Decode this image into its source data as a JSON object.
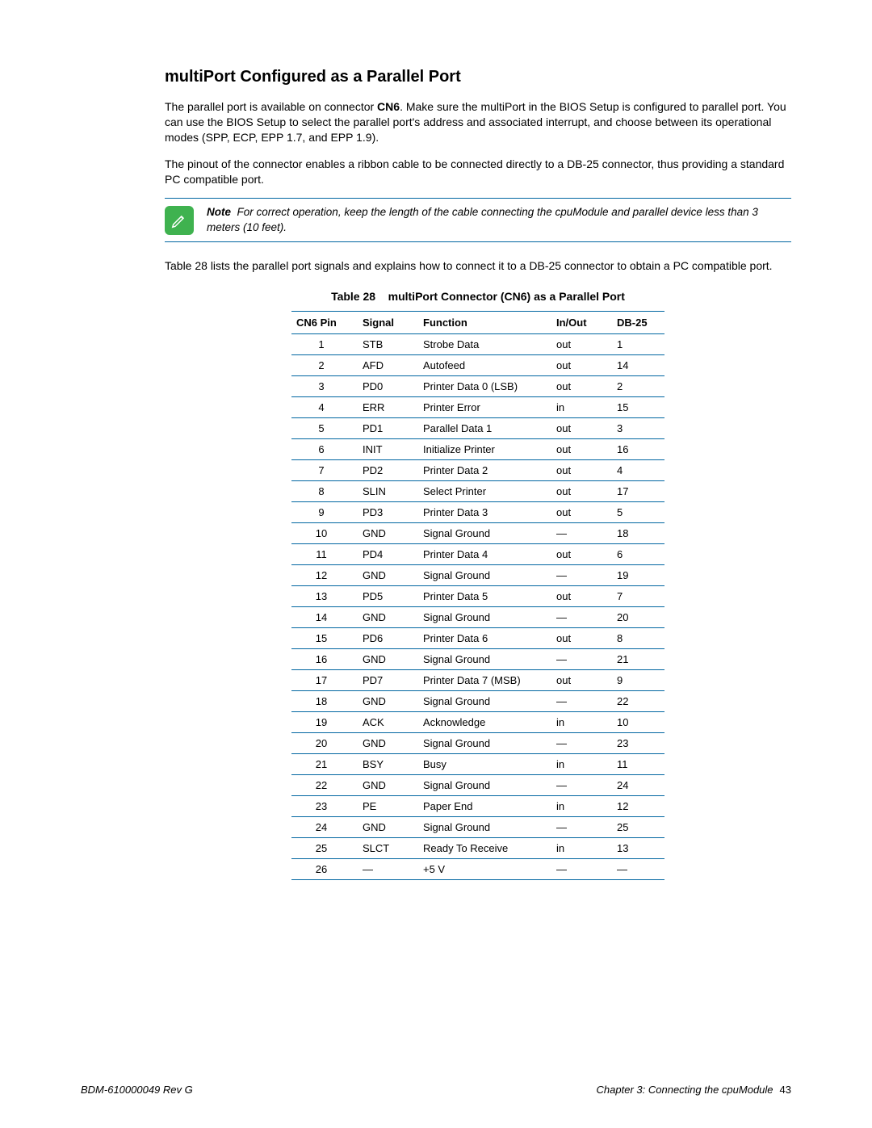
{
  "heading": "multiPort Configured as a Parallel Port",
  "para1_a": "The parallel port is available on connector ",
  "para1_bold": "CN6",
  "para1_b": ". Make sure the multiPort in the BIOS Setup is configured to parallel port. You can use the BIOS Setup to select the parallel port's address and associated interrupt, and choose between its operational modes (SPP, ECP, EPP 1.7, and EPP 1.9).",
  "para2": "The pinout of the connector enables a ribbon cable to be connected directly to a DB-25 connector, thus providing a standard PC compatible port.",
  "note_lead": "Note",
  "note_body": "For correct operation, keep the length of the cable connecting the cpuModule and parallel device less than 3 meters (10 feet).",
  "para3": "Table 28 lists the parallel port signals and explains how to connect it to a DB-25 connector to obtain a PC compatible port.",
  "table_caption_a": "Table 28",
  "table_caption_b": "multiPort Connector (CN6) as a Parallel Port",
  "headers": {
    "c0": "CN6 Pin",
    "c1": "Signal",
    "c2": "Function",
    "c3": "In/Out",
    "c4": "DB-25"
  },
  "rows": [
    {
      "pin": "1",
      "sig": "STB",
      "fn": "Strobe Data",
      "io": "out",
      "db": "1"
    },
    {
      "pin": "2",
      "sig": "AFD",
      "fn": "Autofeed",
      "io": "out",
      "db": "14"
    },
    {
      "pin": "3",
      "sig": "PD0",
      "fn": "Printer Data 0 (LSB)",
      "io": "out",
      "db": "2"
    },
    {
      "pin": "4",
      "sig": "ERR",
      "fn": "Printer Error",
      "io": "in",
      "db": "15"
    },
    {
      "pin": "5",
      "sig": "PD1",
      "fn": "Parallel Data 1",
      "io": "out",
      "db": "3"
    },
    {
      "pin": "6",
      "sig": "INIT",
      "fn": "Initialize Printer",
      "io": "out",
      "db": "16"
    },
    {
      "pin": "7",
      "sig": "PD2",
      "fn": "Printer Data 2",
      "io": "out",
      "db": "4"
    },
    {
      "pin": "8",
      "sig": "SLIN",
      "fn": "Select Printer",
      "io": "out",
      "db": "17"
    },
    {
      "pin": "9",
      "sig": "PD3",
      "fn": "Printer Data 3",
      "io": "out",
      "db": "5"
    },
    {
      "pin": "10",
      "sig": "GND",
      "fn": "Signal Ground",
      "io": "—",
      "db": "18"
    },
    {
      "pin": "11",
      "sig": "PD4",
      "fn": "Printer Data 4",
      "io": "out",
      "db": "6"
    },
    {
      "pin": "12",
      "sig": "GND",
      "fn": "Signal Ground",
      "io": "—",
      "db": "19"
    },
    {
      "pin": "13",
      "sig": "PD5",
      "fn": "Printer Data 5",
      "io": "out",
      "db": "7"
    },
    {
      "pin": "14",
      "sig": "GND",
      "fn": "Signal Ground",
      "io": "—",
      "db": "20"
    },
    {
      "pin": "15",
      "sig": "PD6",
      "fn": "Printer Data 6",
      "io": "out",
      "db": "8"
    },
    {
      "pin": "16",
      "sig": "GND",
      "fn": "Signal Ground",
      "io": "—",
      "db": "21"
    },
    {
      "pin": "17",
      "sig": "PD7",
      "fn": "Printer Data 7 (MSB)",
      "io": "out",
      "db": "9"
    },
    {
      "pin": "18",
      "sig": "GND",
      "fn": "Signal Ground",
      "io": "—",
      "db": "22"
    },
    {
      "pin": "19",
      "sig": "ACK",
      "fn": "Acknowledge",
      "io": "in",
      "db": "10"
    },
    {
      "pin": "20",
      "sig": "GND",
      "fn": "Signal Ground",
      "io": "—",
      "db": "23"
    },
    {
      "pin": "21",
      "sig": "BSY",
      "fn": "Busy",
      "io": "in",
      "db": "11"
    },
    {
      "pin": "22",
      "sig": "GND",
      "fn": "Signal Ground",
      "io": "—",
      "db": "24"
    },
    {
      "pin": "23",
      "sig": "PE",
      "fn": "Paper End",
      "io": "in",
      "db": "12"
    },
    {
      "pin": "24",
      "sig": "GND",
      "fn": "Signal Ground",
      "io": "—",
      "db": "25"
    },
    {
      "pin": "25",
      "sig": "SLCT",
      "fn": "Ready To Receive",
      "io": "in",
      "db": "13"
    },
    {
      "pin": "26",
      "sig": "—",
      "fn": "+5 V",
      "io": "—",
      "db": "—"
    }
  ],
  "footer_left": "BDM-610000049    Rev G",
  "footer_right_a": "Chapter 3:  Connecting the cpuModule",
  "footer_right_b": "43"
}
